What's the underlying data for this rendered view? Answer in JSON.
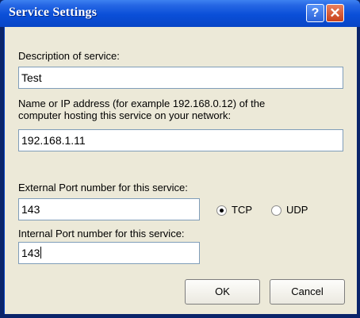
{
  "window": {
    "title": "Service Settings",
    "help_button": "?",
    "close_button": "✕"
  },
  "form": {
    "description_label": "Description of service:",
    "description_value": "Test",
    "host_label_line1": "Name or IP address (for example 192.168.0.12) of the",
    "host_label_line2": "computer hosting this service on your network:",
    "host_value": "192.168.1.11",
    "external_port_label": "External Port number for this service:",
    "external_port_value": "143",
    "protocol_options": [
      {
        "label": "TCP",
        "selected": true
      },
      {
        "label": "UDP",
        "selected": false
      }
    ],
    "internal_port_label": "Internal Port number for this service:",
    "internal_port_value": "143"
  },
  "buttons": {
    "ok_label": "OK",
    "cancel_label": "Cancel"
  }
}
